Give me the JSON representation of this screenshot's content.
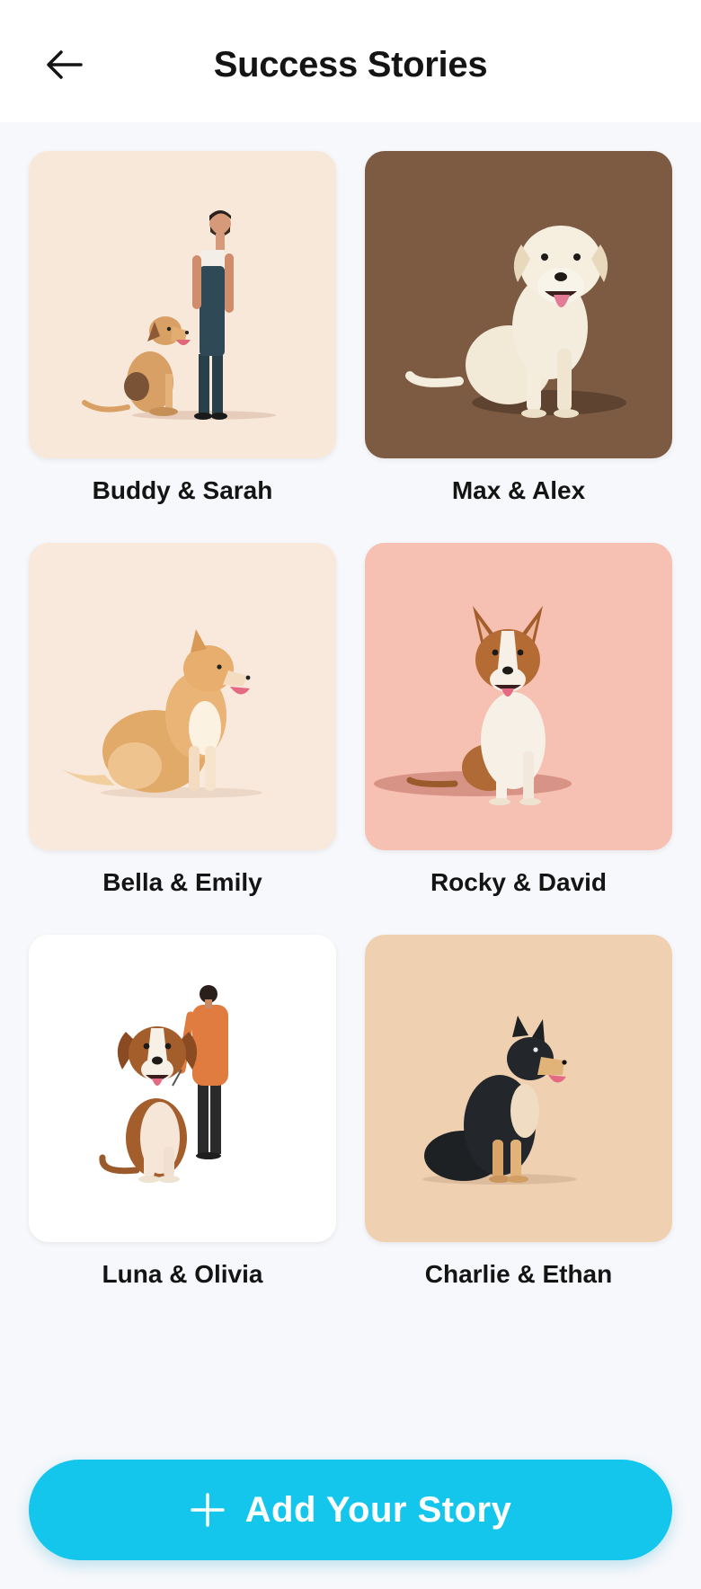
{
  "header": {
    "title": "Success Stories",
    "back_icon": "arrow-left-icon"
  },
  "stories": [
    {
      "label": "Buddy & Sarah",
      "background": "#f8e8da"
    },
    {
      "label": "Max & Alex",
      "background": "#7d5b43"
    },
    {
      "label": "Bella & Emily",
      "background": "#f9e9dd"
    },
    {
      "label": "Rocky & David",
      "background": "#f6c0b2"
    },
    {
      "label": "Luna & Olivia",
      "background": "#ffffff"
    },
    {
      "label": "Charlie & Ethan",
      "background": "#efd1b2"
    }
  ],
  "add_button": {
    "label": "Add Your Story",
    "icon": "plus-icon",
    "color": "#14c6ec"
  }
}
